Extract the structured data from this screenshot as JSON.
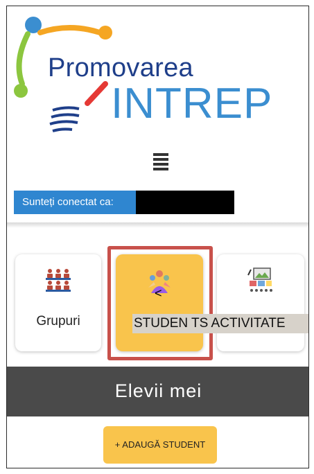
{
  "logo": {
    "line1": "Promovarea",
    "line2": "INTREP",
    "colors": {
      "dark_blue": "#1f3f8a",
      "light_blue": "#3b8ed0",
      "orange": "#f5a623",
      "green": "#8cc63f",
      "red": "#e53935"
    }
  },
  "menu": {
    "icon": "hamburger-menu-icon"
  },
  "session": {
    "connected_label": "Sunteți conectat ca:"
  },
  "cards": [
    {
      "label": "Grupuri",
      "icon": "groups-icon"
    },
    {
      "glyph": "<",
      "label": "STUDEN TS ACTIVITATE",
      "icon": "students-icon"
    },
    {
      "label": "",
      "icon": "activities-icon"
    }
  ],
  "section": {
    "title": "Elevii mei"
  },
  "actions": {
    "add_student": "+ ADAUGĂ STUDENT"
  },
  "colors": {
    "accent_yellow": "#f9c44c",
    "bar_blue": "#2f86d0",
    "section_dark": "#4a4a4a",
    "highlight_red": "#c8514b"
  }
}
